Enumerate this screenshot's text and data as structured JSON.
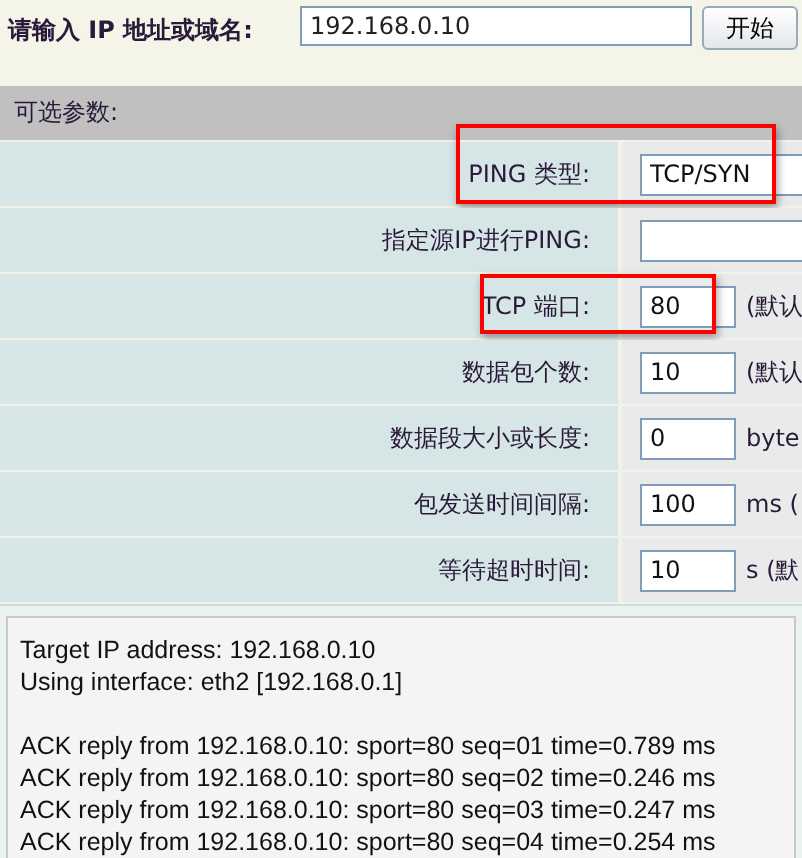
{
  "prompt": {
    "label": "请输入 IP 地址或域名:",
    "value": "192.168.0.10",
    "button": "开始"
  },
  "options": {
    "title": "可选参数:",
    "rows": [
      {
        "label": "PING 类型:",
        "kind": "select",
        "value": "TCP/SYN",
        "highlighted": true
      },
      {
        "label": "指定源IP进行PING:",
        "kind": "text",
        "highlighted": false
      },
      {
        "label": "TCP 端口:",
        "kind": "text",
        "value": "80",
        "unit": "(默认",
        "highlighted": true
      },
      {
        "label": "数据包个数:",
        "kind": "text",
        "value": "10",
        "unit": "(默认",
        "highlighted": false
      },
      {
        "label": "数据段大小或长度:",
        "kind": "text",
        "value": "0",
        "unit": "byte",
        "highlighted": false
      },
      {
        "label": "包发送时间间隔:",
        "kind": "text",
        "value": "100",
        "unit": "ms (",
        "highlighted": false
      },
      {
        "label": "等待超时时间:",
        "kind": "text",
        "value": "10",
        "unit": "s (默",
        "highlighted": false
      }
    ]
  },
  "output": {
    "header": [
      "Target IP address: 192.168.0.10",
      "Using interface: eth2 [192.168.0.1]"
    ],
    "replies": [
      "ACK reply from 192.168.0.10: sport=80 seq=01 time=0.789 ms",
      "ACK reply from 192.168.0.10: sport=80 seq=02 time=0.246 ms",
      "ACK reply from 192.168.0.10: sport=80 seq=03 time=0.247 ms",
      "ACK reply from 192.168.0.10: sport=80 seq=04 time=0.254 ms"
    ]
  }
}
